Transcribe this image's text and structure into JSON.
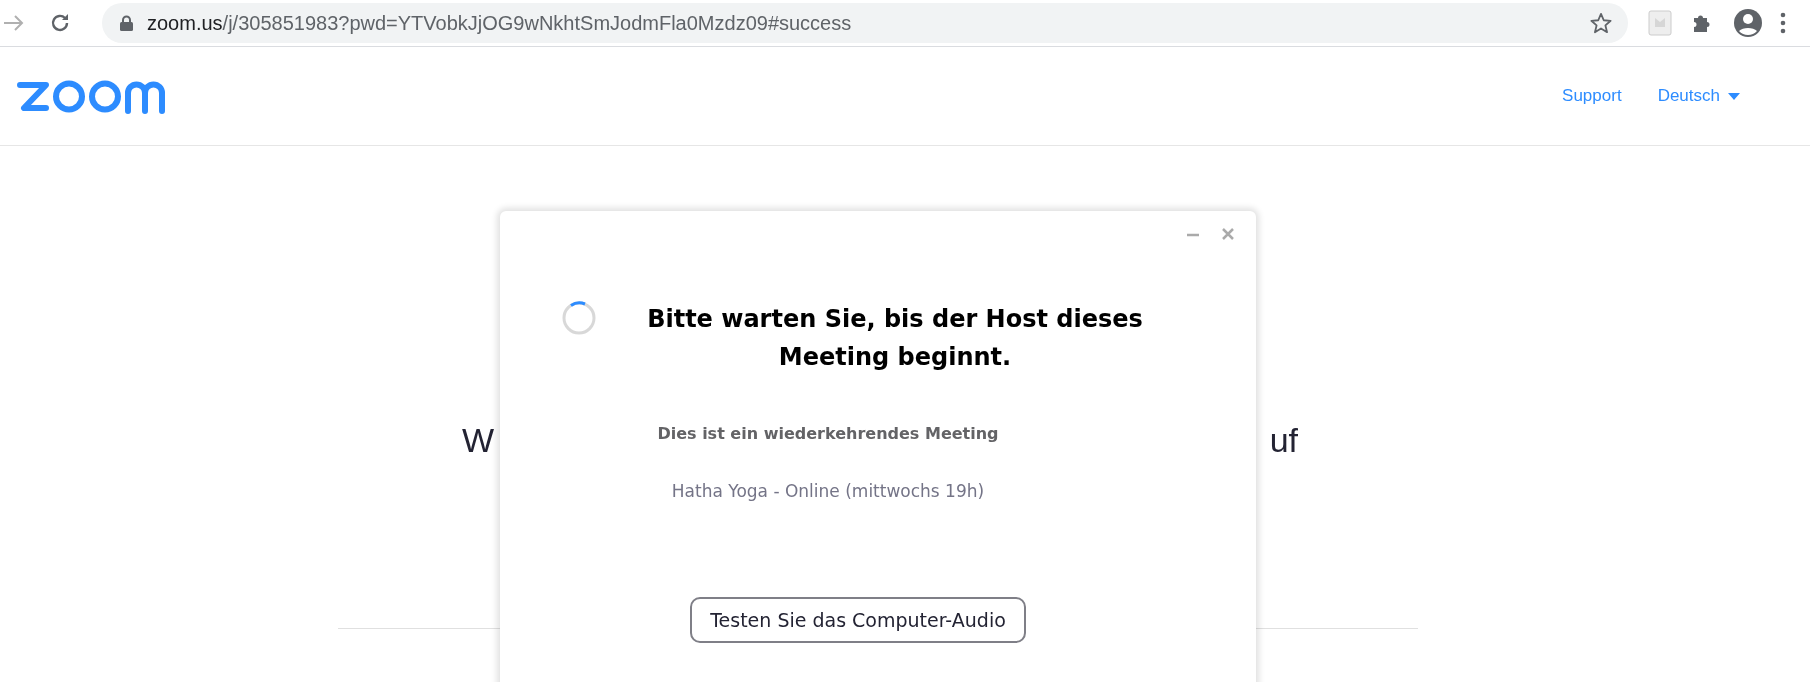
{
  "browser": {
    "url_host": "zoom.us",
    "url_path": "/j/305851983?pwd=YTVobkJjOG9wNkhtSmJodmFla0Mzdz09#success"
  },
  "header": {
    "nav": [
      {
        "label": "Support",
        "kind": "link"
      },
      {
        "label": "Deutsch",
        "kind": "dropdown"
      }
    ]
  },
  "background": {
    "left_fragment": "W",
    "right_fragment": "uf"
  },
  "dialog": {
    "title": "Bitte warten Sie, bis der Host dieses Meeting beginnt.",
    "subtitle": "Dies ist ein wiederkehrendes Meeting",
    "meeting_name": "Hatha Yoga - Online (mittwochs 19h)",
    "button": "Testen Sie das Computer-Audio"
  }
}
